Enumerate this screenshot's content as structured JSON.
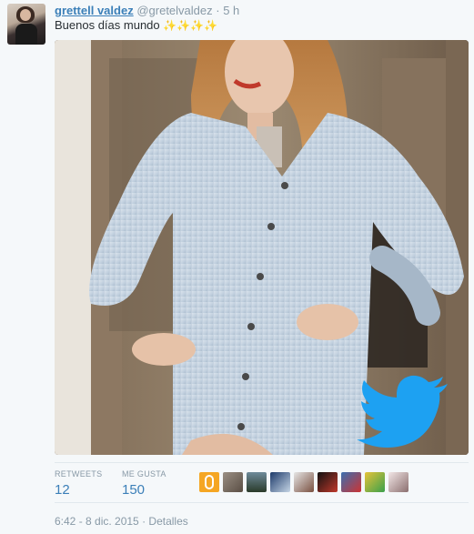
{
  "tweet": {
    "name": "grettell valdez",
    "handle": "@gretelvaldez",
    "separator": "·",
    "time": "5 h",
    "text": "Buenos días mundo",
    "sparkles": "✨✨✨✨"
  },
  "stats": {
    "retweets_label": "RETWEETS",
    "retweets_value": "12",
    "likes_label": "ME GUSTA",
    "likes_value": "150"
  },
  "likers": [
    {
      "icon": "user-avatar-icon"
    },
    {
      "icon": "user-avatar-icon"
    },
    {
      "icon": "user-avatar-icon"
    },
    {
      "icon": "user-avatar-icon"
    },
    {
      "icon": "user-avatar-icon"
    },
    {
      "icon": "user-avatar-icon"
    },
    {
      "icon": "user-avatar-icon"
    },
    {
      "icon": "user-avatar-icon"
    },
    {
      "icon": "user-avatar-icon"
    },
    {
      "icon": "user-avatar-icon"
    }
  ],
  "footer": {
    "datetime": "6:42 - 8 dic. 2015",
    "separator": "·",
    "details": "Detalles"
  },
  "colors": {
    "link": "#3b7fb8",
    "muted": "#8899a6",
    "twitter_bird": "#1da1f2"
  }
}
